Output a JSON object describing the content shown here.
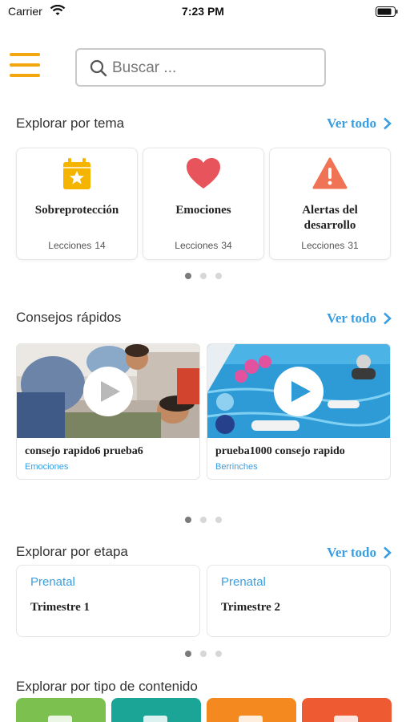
{
  "status_bar": {
    "carrier": "Carrier",
    "time": "7:23 PM"
  },
  "search": {
    "placeholder": "Buscar ..."
  },
  "topics": {
    "title": "Explorar por tema",
    "see_all": "Ver todo",
    "items": [
      {
        "name": "Sobreprotección",
        "lessons_label": "Lecciones",
        "lessons": "14",
        "icon": "calendar-star-icon",
        "color": "#f4b400"
      },
      {
        "name": "Emociones",
        "lessons_label": "Lecciones",
        "lessons": "34",
        "icon": "heart-icon",
        "color": "#e8545c"
      },
      {
        "name": "Alertas del desarrollo",
        "lessons_label": "Lecciones",
        "lessons": "31",
        "icon": "warning-icon",
        "color": "#f07355"
      }
    ]
  },
  "tips": {
    "title": "Consejos rápidos",
    "see_all": "Ver todo",
    "items": [
      {
        "title": "consejo rapido6 prueba6",
        "tag": "Emociones"
      },
      {
        "title": "prueba1000 consejo rapido",
        "tag": "Berrinches"
      }
    ]
  },
  "stages": {
    "title": "Explorar por etapa",
    "see_all": "Ver todo",
    "items": [
      {
        "label": "Prenatal",
        "name": "Trimestre 1"
      },
      {
        "label": "Prenatal",
        "name": "Trimestre 2"
      }
    ]
  },
  "content_types": {
    "title": "Explorar por tipo de contenido",
    "colors": [
      "#7cc150",
      "#1aa597",
      "#f48a1f",
      "#ee5a32"
    ]
  },
  "colors": {
    "accent": "#3a9ee0",
    "menu": "#f2a60f"
  }
}
